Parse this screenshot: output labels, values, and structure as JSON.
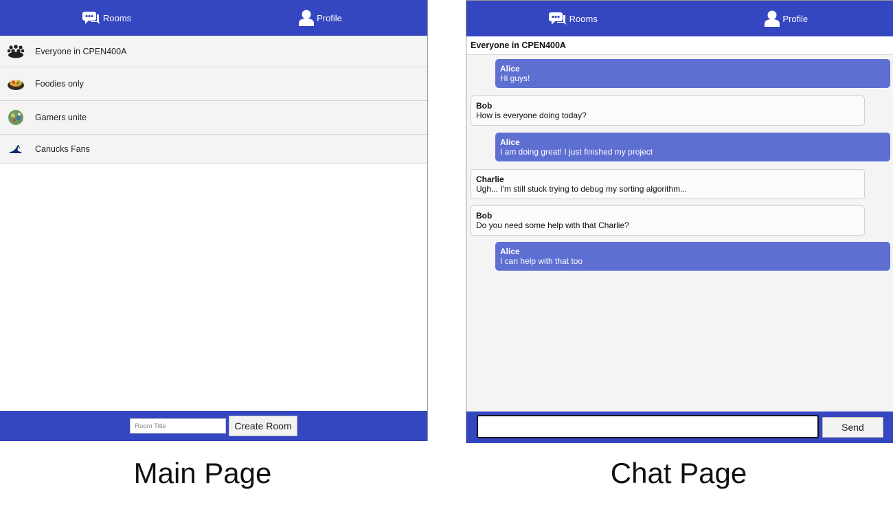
{
  "nav": {
    "rooms_label": "Rooms",
    "profile_label": "Profile"
  },
  "main_page": {
    "rooms": [
      {
        "name": "Everyone in CPEN400A",
        "icon": "group-icon"
      },
      {
        "name": "Foodies only",
        "icon": "food-bowl-icon"
      },
      {
        "name": "Gamers unite",
        "icon": "game-controller-icon"
      },
      {
        "name": "Canucks Fans",
        "icon": "canucks-logo-icon"
      }
    ],
    "room_title_placeholder": "Room Title",
    "create_room_label": "Create Room"
  },
  "chat_page": {
    "room_title": "Everyone in CPEN400A",
    "messages": [
      {
        "user": "Alice",
        "text": "Hi guys!",
        "self": true
      },
      {
        "user": "Bob",
        "text": "How is everyone doing today?",
        "self": false
      },
      {
        "user": "Alice",
        "text": "I am doing great! I just finished my project",
        "self": true
      },
      {
        "user": "Charlie",
        "text": "Ugh... I'm still stuck trying to debug my sorting algorithm...",
        "self": false
      },
      {
        "user": "Bob",
        "text": "Do you need some help with that Charlie?",
        "self": false
      },
      {
        "user": "Alice",
        "text": "I can help with that too",
        "self": true
      }
    ],
    "send_label": "Send"
  },
  "captions": {
    "main": "Main Page",
    "chat": "Chat Page"
  },
  "colors": {
    "nav_blue": "#3446c0",
    "own_message": "#5e6fd2",
    "other_message": "#fbfbfb"
  }
}
